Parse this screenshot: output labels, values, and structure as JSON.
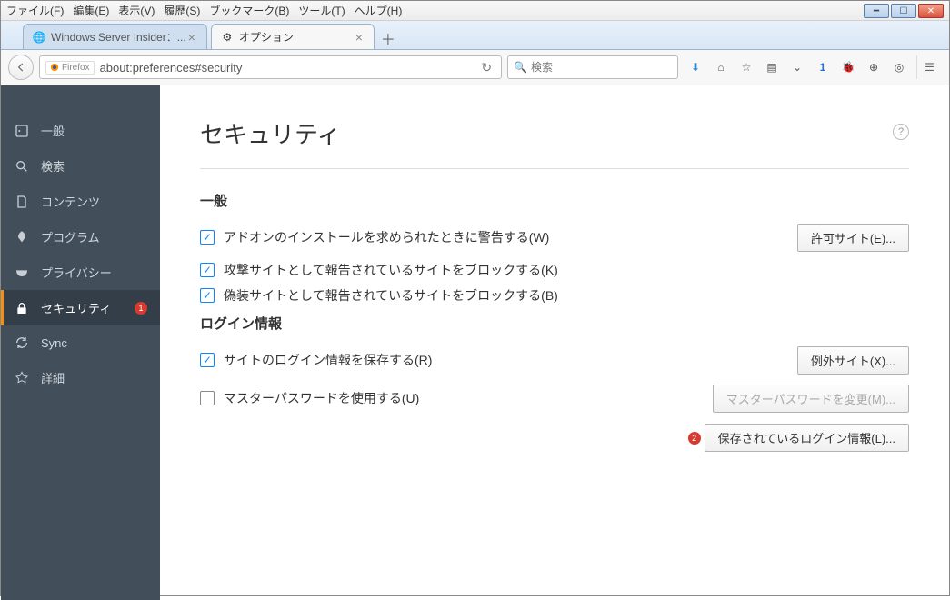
{
  "menubar": {
    "file": "ファイル(F)",
    "edit": "編集(E)",
    "view": "表示(V)",
    "history": "履歴(S)",
    "bookmarks": "ブックマーク(B)",
    "tools": "ツール(T)",
    "help": "ヘルプ(H)"
  },
  "tabs": {
    "tab1_label": "Windows Server Insider：...",
    "tab2_label": "オプション"
  },
  "url": {
    "identity_label": "Firefox",
    "value": "about:preferences#security",
    "search_placeholder": "検索"
  },
  "sidebar": {
    "general": "一般",
    "search": "検索",
    "content": "コンテンツ",
    "programs": "プログラム",
    "privacy": "プライバシー",
    "security": "セキュリティ",
    "sync": "Sync",
    "advanced": "詳細",
    "security_badge": "1"
  },
  "page": {
    "title": "セキュリティ",
    "general_heading": "一般",
    "warn_addon": "アドオンのインストールを求められたときに警告する(W)",
    "block_attack": "攻撃サイトとして報告されているサイトをブロックする(K)",
    "block_forgery": "偽装サイトとして報告されているサイトをブロックする(B)",
    "permitted_sites_btn": "許可サイト(E)...",
    "login_heading": "ログイン情報",
    "save_login": "サイトのログイン情報を保存する(R)",
    "exceptions_btn": "例外サイト(X)...",
    "use_master": "マスターパスワードを使用する(U)",
    "change_master_btn": "マスターパスワードを変更(M)...",
    "saved_logins_btn": "保存されているログイン情報(L)...",
    "anno2": "2"
  }
}
